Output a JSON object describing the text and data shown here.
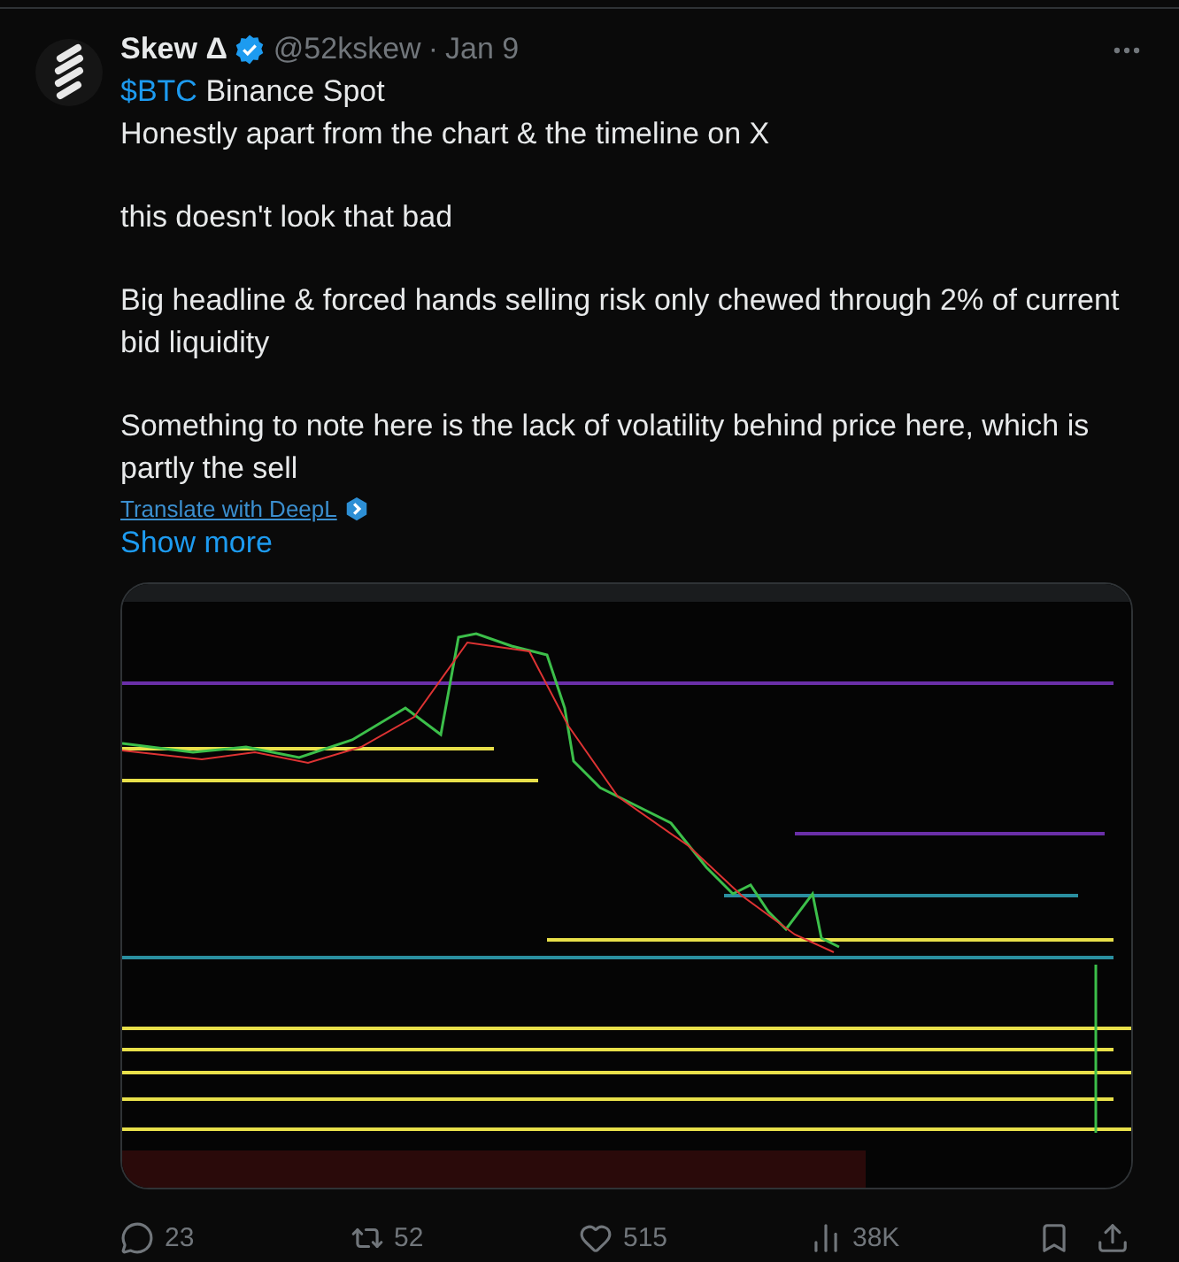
{
  "tweet": {
    "author": {
      "name": "Skew Δ",
      "verified": true,
      "handle": "@52kskew",
      "separator": "·",
      "date": "Jan 9"
    },
    "body": {
      "cashtag": "$BTC",
      "first_line": " Binance Spot",
      "paragraphs": [
        "Honestly apart from the chart & the timeline on X",
        "this doesn't look that bad",
        "Big headline & forced hands selling risk only chewed through 2% of current bid liquidity",
        "Something to note here is the lack of volatility behind price here, which is partly the sell"
      ]
    },
    "translate_link": "Translate with DeepL",
    "show_more": "Show more",
    "actions": [
      {
        "kind": "reply",
        "count": "23"
      },
      {
        "kind": "repost",
        "count": "52"
      },
      {
        "kind": "like",
        "count": "515"
      },
      {
        "kind": "views",
        "count": "38K"
      }
    ]
  }
}
